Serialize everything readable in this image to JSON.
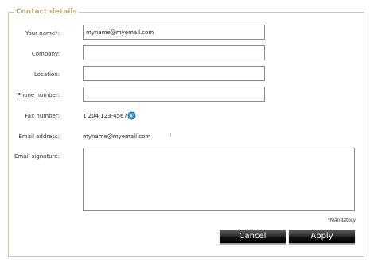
{
  "section": {
    "title": "Contact details"
  },
  "fields": {
    "your_name": {
      "label": "Your name*:",
      "value": "myname@myemail.com",
      "placeholder": ""
    },
    "company": {
      "label": "Company:",
      "value": "",
      "placeholder": ""
    },
    "location": {
      "label": "Location:",
      "value": "",
      "placeholder": ""
    },
    "phone_number": {
      "label": "Phone number:",
      "value": "",
      "placeholder": ""
    },
    "fax_number": {
      "label": "Fax number:",
      "value": "1 204 123-4567"
    },
    "email_address": {
      "label": "Email address:",
      "value": "myname@myemail.com"
    },
    "email_signature": {
      "label": "Email signature:",
      "value": ""
    }
  },
  "icons": {
    "cursor": "hand-pointer-cursor-icon"
  },
  "footer": {
    "mandatory_note": "*Mandatory",
    "cancel_label": "Cancel",
    "apply_label": "Apply"
  },
  "colors": {
    "section_title": "#c2ad85",
    "fieldset_border": "#cfc8a6",
    "button_bg": "#000000",
    "button_text": "#ffffff",
    "input_border": "#8a8a8a"
  }
}
